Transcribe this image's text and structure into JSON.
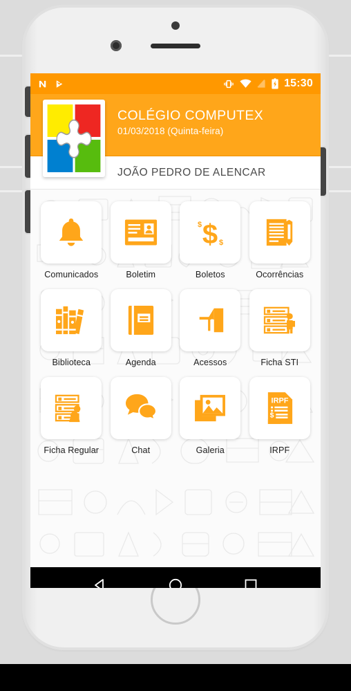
{
  "statusbar": {
    "time": "15:30",
    "left_icons": [
      "n-notification-icon",
      "play-check-notification-icon"
    ],
    "right_icons": [
      "vibrate-icon",
      "wifi-icon",
      "signal-off-icon",
      "battery-charging-icon"
    ]
  },
  "header": {
    "school_name": "COLÉGIO COMPUTEX",
    "date": "01/03/2018 (Quinta-feira)",
    "logo_alt": "puzzle-logo",
    "logo_colors": {
      "top_left": "#FFEC00",
      "top_right": "#EE2722",
      "bottom_left": "#0080D0",
      "bottom_right": "#57BC0E"
    },
    "accent_color": "#FFA61A",
    "statusbar_color": "#FF9800"
  },
  "student": {
    "name": "JOÃO PEDRO DE ALENCAR"
  },
  "menu": {
    "icon_color": "#FFA61A",
    "items": [
      {
        "label": "Comunicados",
        "icon": "bell-icon"
      },
      {
        "label": "Boletim",
        "icon": "id-card-icon"
      },
      {
        "label": "Boletos",
        "icon": "dollar-icon"
      },
      {
        "label": "Ocorrências",
        "icon": "document-pencil-icon"
      },
      {
        "label": "Biblioteca",
        "icon": "books-icon"
      },
      {
        "label": "Agenda",
        "icon": "notebook-icon"
      },
      {
        "label": "Acessos",
        "icon": "turnstile-icon"
      },
      {
        "label": "Ficha STI",
        "icon": "checklist-student-icon"
      },
      {
        "label": "Ficha Regular",
        "icon": "checklist-person-icon"
      },
      {
        "label": "Chat",
        "icon": "chat-bubbles-icon"
      },
      {
        "label": "Galeria",
        "icon": "photos-icon"
      },
      {
        "label": "IRPF",
        "icon": "irpf-document-icon"
      }
    ]
  },
  "navbar": {
    "buttons": [
      {
        "name": "back-button",
        "icon": "triangle-back-icon"
      },
      {
        "name": "home-button",
        "icon": "circle-home-icon"
      },
      {
        "name": "recents-button",
        "icon": "square-recents-icon"
      }
    ]
  }
}
